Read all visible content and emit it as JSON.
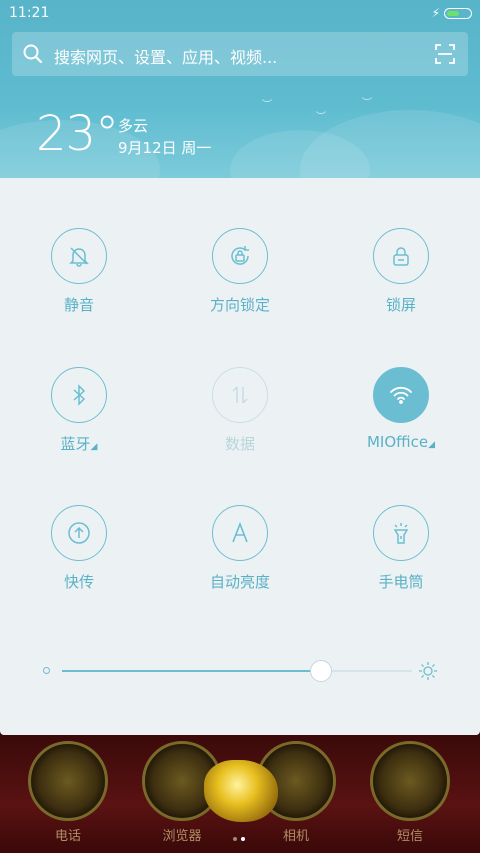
{
  "status": {
    "time": "11:21",
    "charging_icon": "bolt-icon",
    "battery_percent": 57
  },
  "search": {
    "placeholder": "搜索网页、设置、应用、视频..."
  },
  "weather": {
    "temperature": "23°",
    "condition": "多云",
    "date": "9月12日 周一"
  },
  "toggles": [
    {
      "label": "静音",
      "icon": "bell-off-icon",
      "state": "off"
    },
    {
      "label": "方向锁定",
      "icon": "rotation-lock-icon",
      "state": "off"
    },
    {
      "label": "锁屏",
      "icon": "lock-icon",
      "state": "off"
    },
    {
      "label": "蓝牙",
      "icon": "bluetooth-icon",
      "state": "off",
      "expandable": true
    },
    {
      "label": "数据",
      "icon": "data-icon",
      "state": "disabled"
    },
    {
      "label": "MIOffice",
      "icon": "wifi-icon",
      "state": "on",
      "expandable": true
    },
    {
      "label": "快传",
      "icon": "transfer-icon",
      "state": "off"
    },
    {
      "label": "自动亮度",
      "icon": "auto-brightness-icon",
      "state": "off"
    },
    {
      "label": "手电筒",
      "icon": "flashlight-icon",
      "state": "off"
    }
  ],
  "brightness": {
    "level": 0.74
  },
  "dock": {
    "labels": [
      "电话",
      "浏览器",
      "相机",
      "短信"
    ],
    "page_count": 2,
    "active_page": 2
  },
  "colors": {
    "accent": "#6bbed1",
    "header": "#5fbcd0",
    "panel": "#ecf2f4"
  }
}
